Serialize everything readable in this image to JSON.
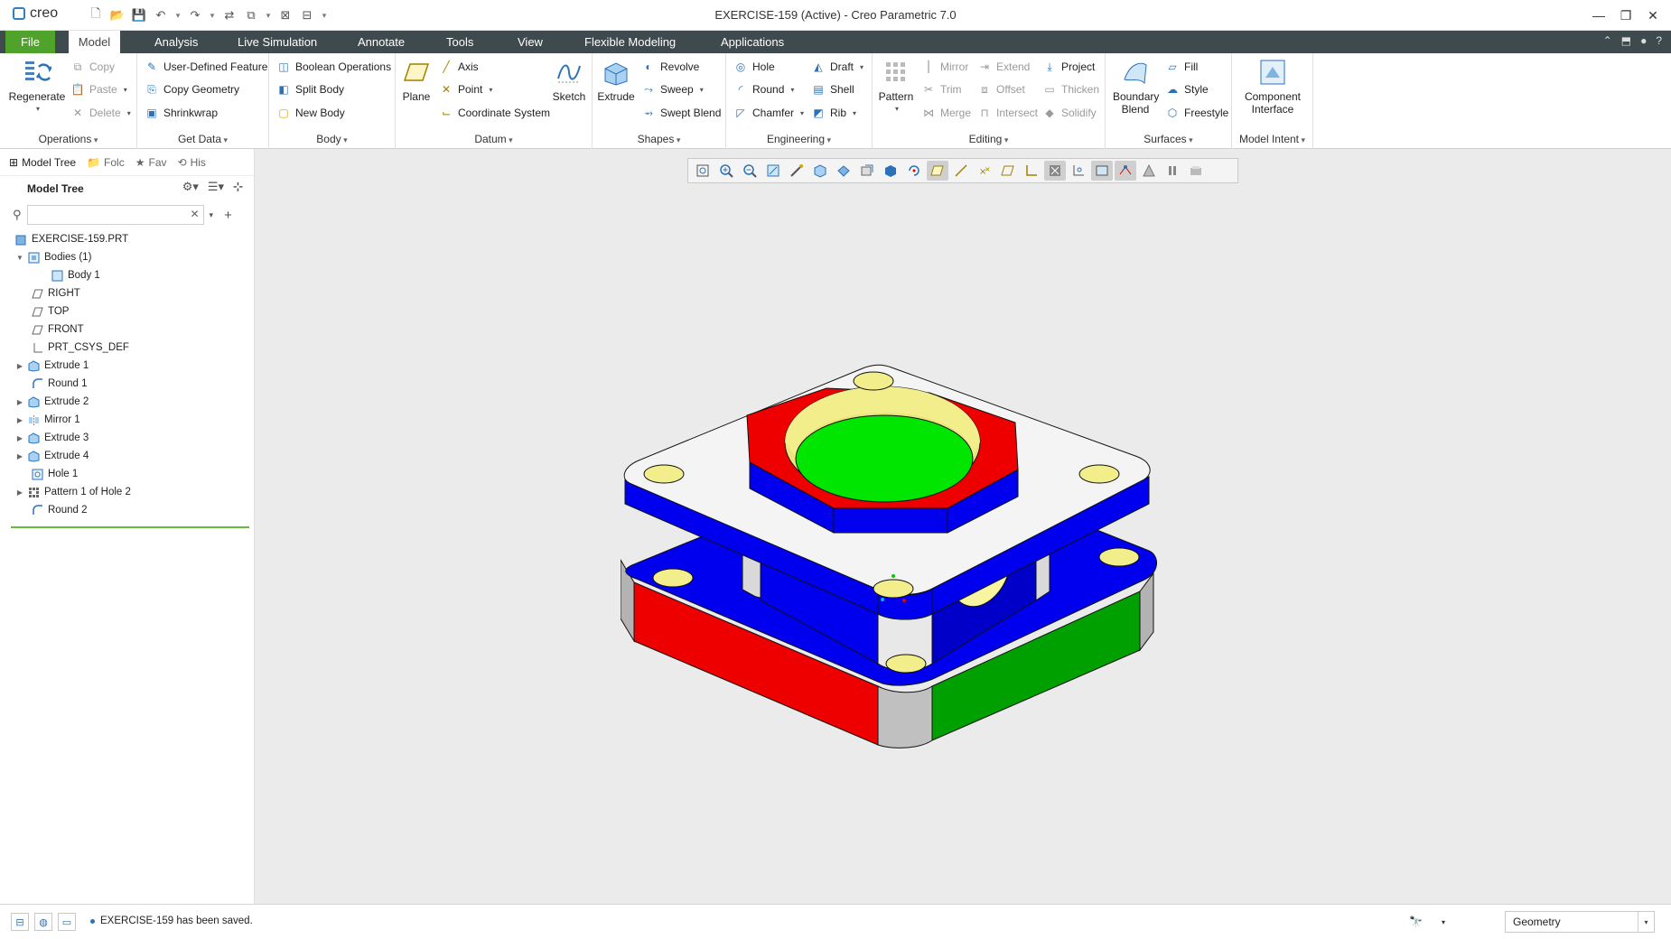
{
  "window": {
    "app_name": "creo",
    "title": "EXERCISE-159 (Active) - Creo Parametric 7.0"
  },
  "menu": {
    "file": "File",
    "tabs": [
      "Model",
      "Analysis",
      "Live Simulation",
      "Annotate",
      "Tools",
      "View",
      "Flexible Modeling",
      "Applications"
    ],
    "active_tab": "Model"
  },
  "ribbon": {
    "operations": {
      "label": "Operations",
      "regenerate": "Regenerate",
      "copy": "Copy",
      "paste": "Paste",
      "delete": "Delete"
    },
    "get_data": {
      "label": "Get Data",
      "user_defined_feature": "User-Defined Feature",
      "copy_geometry": "Copy Geometry",
      "shrinkwrap": "Shrinkwrap"
    },
    "body": {
      "label": "Body",
      "boolean_operations": "Boolean Operations",
      "split_body": "Split Body",
      "new_body": "New Body"
    },
    "datum": {
      "label": "Datum",
      "plane": "Plane",
      "axis": "Axis",
      "point": "Point",
      "coordinate_system": "Coordinate System",
      "sketch": "Sketch"
    },
    "shapes": {
      "label": "Shapes",
      "extrude": "Extrude",
      "revolve": "Revolve",
      "sweep": "Sweep",
      "swept_blend": "Swept Blend"
    },
    "engineering": {
      "label": "Engineering",
      "hole": "Hole",
      "round": "Round",
      "chamfer": "Chamfer",
      "draft": "Draft",
      "shell": "Shell",
      "rib": "Rib"
    },
    "editing": {
      "label": "Editing",
      "pattern": "Pattern",
      "mirror": "Mirror",
      "trim": "Trim",
      "merge": "Merge",
      "extend": "Extend",
      "offset": "Offset",
      "intersect": "Intersect",
      "project": "Project",
      "thicken": "Thicken",
      "solidify": "Solidify"
    },
    "surfaces": {
      "label": "Surfaces",
      "boundary_blend": "Boundary Blend",
      "fill": "Fill",
      "style": "Style",
      "freestyle": "Freestyle"
    },
    "model_intent": {
      "label": "Model Intent",
      "component_interface": "Component Interface"
    }
  },
  "panel": {
    "tabs": [
      "Model Tree",
      "Folc",
      "Fav",
      "His"
    ],
    "tree_title": "Model Tree",
    "search_value": "",
    "items": [
      {
        "label": "EXERCISE-159.PRT",
        "icon": "part-icon"
      },
      {
        "label": "Bodies (1)",
        "icon": "bodies-icon"
      },
      {
        "label": "Body 1",
        "icon": "body-icon"
      },
      {
        "label": "RIGHT",
        "icon": "datum-plane-icon"
      },
      {
        "label": "TOP",
        "icon": "datum-plane-icon"
      },
      {
        "label": "FRONT",
        "icon": "datum-plane-icon"
      },
      {
        "label": "PRT_CSYS_DEF",
        "icon": "csys-icon"
      },
      {
        "label": "Extrude 1",
        "icon": "extrude-icon"
      },
      {
        "label": "Round 1",
        "icon": "round-icon"
      },
      {
        "label": "Extrude 2",
        "icon": "extrude-icon"
      },
      {
        "label": "Mirror 1",
        "icon": "mirror-icon"
      },
      {
        "label": "Extrude 3",
        "icon": "extrude-icon"
      },
      {
        "label": "Extrude 4",
        "icon": "extrude-icon"
      },
      {
        "label": "Hole 1",
        "icon": "hole-icon"
      },
      {
        "label": "Pattern 1 of Hole 2",
        "icon": "pattern-icon"
      },
      {
        "label": "Round 2",
        "icon": "round-icon"
      }
    ]
  },
  "status": {
    "message": "EXERCISE-159 has been saved.",
    "filter_value": "Geometry"
  },
  "colors": {
    "file_tab": "#4fa32b",
    "menubar": "#3f4a4f",
    "model_blue": "#0000ee",
    "model_red": "#ee0000",
    "model_green": "#00cc00",
    "hole_yellow": "#f2ee8c"
  }
}
